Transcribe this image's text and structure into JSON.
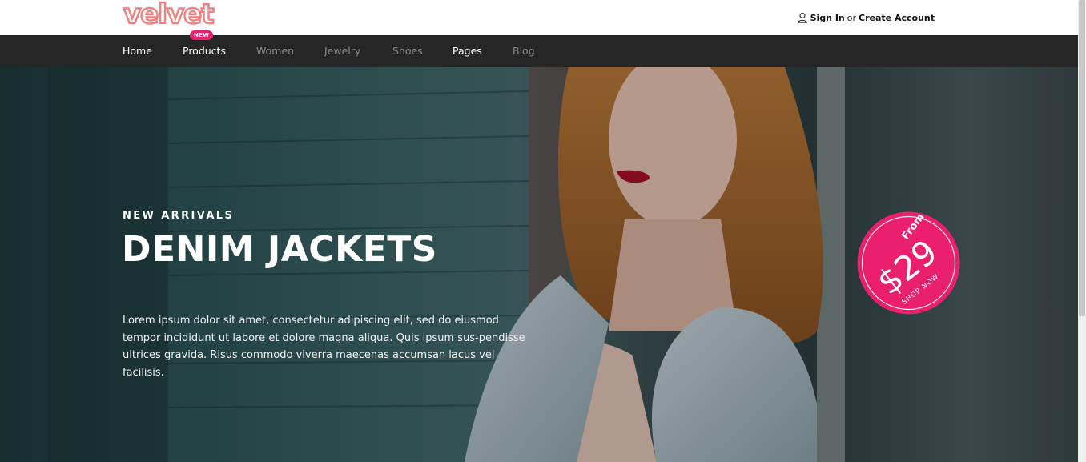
{
  "brand": {
    "logo_text": "velvet",
    "accent": "#ea1f6d",
    "logo_color": "#f0817f"
  },
  "account": {
    "sign_in": "Sign In",
    "separator": "or",
    "create": "Create Account"
  },
  "nav": {
    "items": [
      {
        "label": "Home",
        "active": true
      },
      {
        "label": "Products",
        "active": true
      },
      {
        "label": "Women",
        "active": false
      },
      {
        "label": "Jewelry",
        "active": false
      },
      {
        "label": "Shoes",
        "active": false
      },
      {
        "label": "Pages",
        "active": true
      },
      {
        "label": "Blog",
        "active": false
      }
    ],
    "badge": "NEW"
  },
  "hero": {
    "kicker": "NEW ARRIVALS",
    "headline": "DENIM JACKETS",
    "body": "Lorem ipsum dolor sit amet, consectetur adipiscing elit, sed do eiusmod tempor incididunt ut labore et dolore magna aliqua. Quis ipsum sus-pendisse ultrices gravida. Risus commodo viverra maecenas accumsan lacus vel facilisis."
  },
  "promo": {
    "from": "From",
    "price": "$29",
    "cta": "SHOP NOW"
  }
}
